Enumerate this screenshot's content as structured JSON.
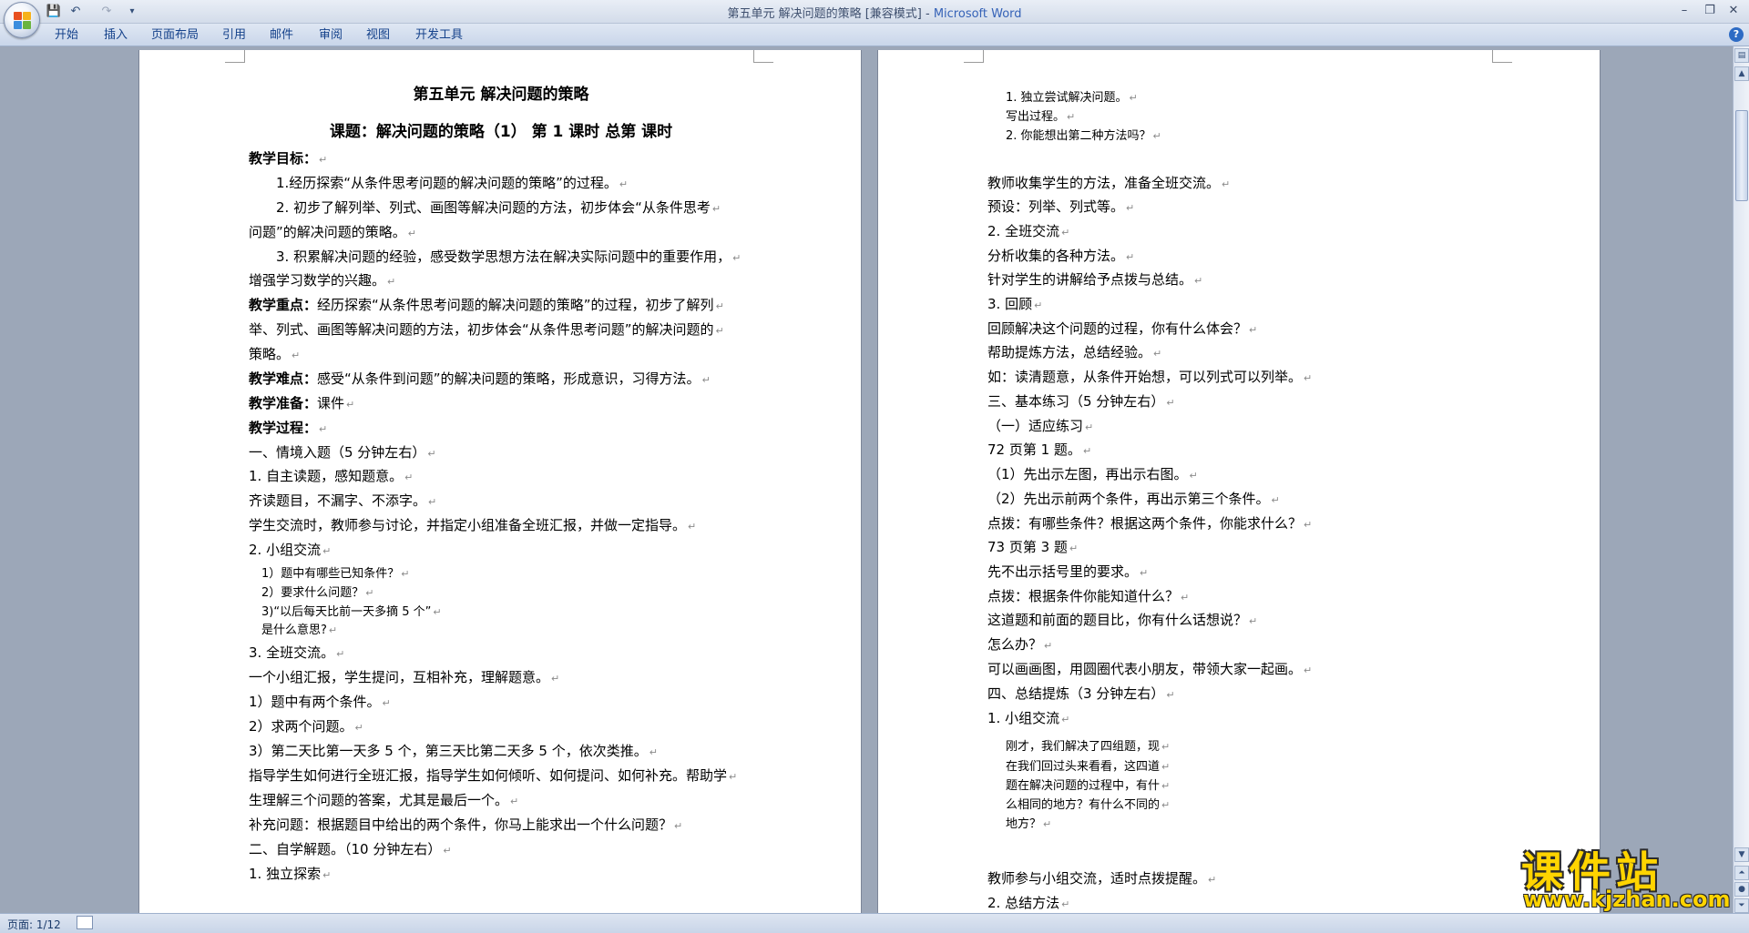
{
  "window": {
    "title_doc": "第五单元  解决问题的策略 [兼容模式] - ",
    "title_app": "Microsoft Word"
  },
  "quick_access": {
    "save": "💾",
    "undo": "↶",
    "redo": "↷",
    "customize": "▾"
  },
  "ribbon": {
    "tabs": [
      "开始",
      "插入",
      "页面布局",
      "引用",
      "邮件",
      "审阅",
      "视图",
      "开发工具"
    ],
    "help": "?"
  },
  "page1": {
    "title": "第五单元   解决问题的策略",
    "subtitle": "课题：解决问题的策略（1）    第  1  课时     总第     课时",
    "lines": [
      {
        "t": "教学目标：",
        "bold": true
      },
      {
        "t": "1.经历探索“从条件思考问题的解决问题的策略”的过程。",
        "indent": true
      },
      {
        "t": "2. 初步了解列举、列式、画图等解决问题的方法，初步体会“从条件思考",
        "indent": true
      },
      {
        "t": "问题”的解决问题的策略。"
      },
      {
        "t": "3. 积累解决问题的经验，感受数学思想方法在解决实际问题中的重要作用，",
        "indent": true
      },
      {
        "t": "增强学习数学的兴趣。"
      },
      {
        "t": "教学重点：经历探索“从条件思考问题的解决问题的策略”的过程，初步了解列",
        "boldlead": "教学重点："
      },
      {
        "t": "举、列式、画图等解决问题的方法，初步体会“从条件思考问题”的解决问题的"
      },
      {
        "t": "策略。"
      },
      {
        "t": "教学难点：感受“从条件到问题”的解决问题的策略，形成意识，习得方法。",
        "boldlead": "教学难点："
      },
      {
        "t": "教学准备：课件",
        "boldlead": "教学准备："
      },
      {
        "t": "教学过程：",
        "bold": true
      },
      {
        "t": "一、情境入题（5 分钟左右）"
      },
      {
        "t": "1. 自主读题，感知题意。"
      },
      {
        "t": "齐读题目，不漏字、不添字。"
      },
      {
        "t": "学生交流时，教师参与讨论，并指定小组准备全班汇报，并做一定指导。"
      },
      {
        "t": "2. 小组交流"
      },
      {
        "t": "1）题中有哪些已知条件？",
        "small": true
      },
      {
        "t": "2）要求什么问题？",
        "small": true
      },
      {
        "t": "3)“以后每天比前一天多摘 5 个”",
        "small": true
      },
      {
        "t": "是什么意思?",
        "small": true
      },
      {
        "t": "3. 全班交流。"
      },
      {
        "t": "一个小组汇报，学生提问，互相补充，理解题意。"
      },
      {
        "t": "1）题中有两个条件。"
      },
      {
        "t": "2）求两个问题。"
      },
      {
        "t": "3）第二天比第一天多 5 个，第三天比第二天多 5 个，依次类推。"
      },
      {
        "t": "指导学生如何进行全班汇报，指导学生如何倾听、如何提问、如何补充。帮助学"
      },
      {
        "t": "生理解三个问题的答案，尤其是最后一个。"
      },
      {
        "t": "补充问题：根据题目中给出的两个条件，你马上能求出一个什么问题？"
      },
      {
        "t": "二、自学解题。（10 分钟左右）"
      },
      {
        "t": "1. 独立探索"
      }
    ]
  },
  "page2": {
    "lines": [
      {
        "t": "1. 独立尝试解决问题。",
        "small": true
      },
      {
        "t": "写出过程。",
        "small": true
      },
      {
        "t": "2. 你能想出第二种方法吗？",
        "small": true
      },
      {
        "t": "教师收集学生的方法，准备全班交流。"
      },
      {
        "t": "预设：列举、列式等。"
      },
      {
        "t": "2. 全班交流"
      },
      {
        "t": "分析收集的各种方法。"
      },
      {
        "t": "针对学生的讲解给予点拨与总结。"
      },
      {
        "t": "3. 回顾"
      },
      {
        "t": "回顾解决这个问题的过程，你有什么体会？"
      },
      {
        "t": "帮助提炼方法，总结经验。"
      },
      {
        "t": "如：读清题意，从条件开始想，可以列式可以列举。"
      },
      {
        "t": "三、基本练习（5 分钟左右）"
      },
      {
        "t": "（一）适应练习"
      },
      {
        "t": "72 页第 1 题。"
      },
      {
        "t": "（1）先出示左图，再出示右图。"
      },
      {
        "t": "（2）先出示前两个条件，再出示第三个条件。"
      },
      {
        "t": "点拨：有哪些条件？根据这两个条件，你能求什么？"
      },
      {
        "t": "73 页第 3 题"
      },
      {
        "t": "先不出示括号里的要求。"
      },
      {
        "t": "点拨：根据条件你能知道什么？"
      },
      {
        "t": "这道题和前面的题目比，你有什么话想说？"
      },
      {
        "t": "怎么办？"
      },
      {
        "t": "可以画画图，用圆圈代表小朋友，带领大家一起画。"
      },
      {
        "t": "四、总结提炼（3 分钟左右）"
      },
      {
        "t": "1. 小组交流"
      },
      {
        "t": "刚才，我们解决了四组题，现",
        "small": true
      },
      {
        "t": "在我们回过头来看看，这四道",
        "small": true
      },
      {
        "t": "题在解决问题的过程中，有什",
        "small": true
      },
      {
        "t": "么相同的地方？有什么不同的",
        "small": true
      },
      {
        "t": "地方？",
        "small": true
      },
      {
        "t": "教师参与小组交流，适时点拨提醒。"
      },
      {
        "t": "2. 总结方法"
      }
    ]
  },
  "para_mark": "↵",
  "statusbar": {
    "page_info": "页面: 1/12"
  },
  "watermark": {
    "brand": "课件站",
    "url": "www.kjzhan.com"
  },
  "colors": {
    "page_bg": "#ffffff",
    "workspace_bg": "#9ca7b8",
    "accent": "#15428b"
  }
}
